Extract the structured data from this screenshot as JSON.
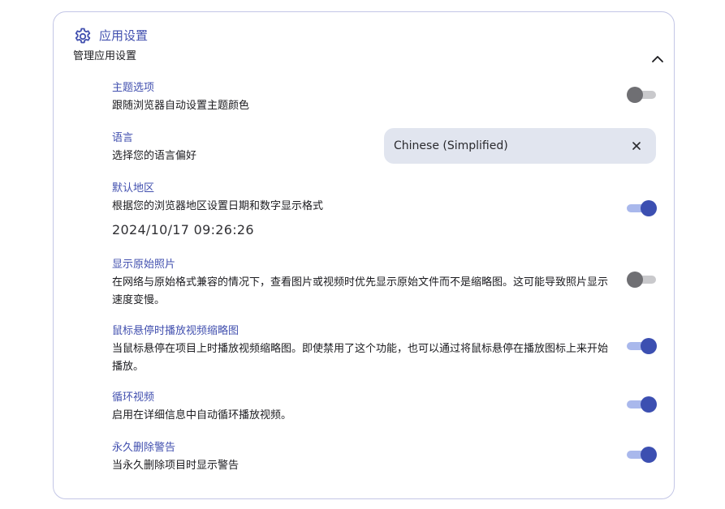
{
  "card": {
    "title": "应用设置",
    "subtitle": "管理应用设置",
    "icon": "gear-icon",
    "collapse_icon": "chevron-up-icon"
  },
  "colors": {
    "accent": "#4250af",
    "toggle_on_thumb": "#3c4fb1",
    "toggle_on_track": "#a9b8ec",
    "toggle_off_thumb": "#6f6f73",
    "toggle_off_track": "#c9c9cc",
    "select_bg": "#e1e5ef"
  },
  "settings": {
    "theme": {
      "title": "主题选项",
      "desc": "跟随浏览器自动设置主题颜色",
      "enabled": false
    },
    "language": {
      "title": "语言",
      "desc": "选择您的语言偏好",
      "value": "Chinese (Simplified)",
      "clear_icon": "close-icon"
    },
    "locale": {
      "title": "默认地区",
      "desc": "根据您的浏览器地区设置日期和数字显示格式",
      "example": "2024/10/17 09:26:26",
      "enabled": true
    },
    "original_photos": {
      "title": "显示原始照片",
      "desc": "在网络与原始格式兼容的情况下，查看图片或视频时优先显示原始文件而不是缩略图。这可能导致照片显示速度变慢。",
      "enabled": false
    },
    "hover_play": {
      "title": "鼠标悬停时播放视频缩略图",
      "desc": "当鼠标悬停在项目上时播放视频缩略图。即使禁用了这个功能，也可以通过将鼠标悬停在播放图标上来开始播放。",
      "enabled": true
    },
    "loop_video": {
      "title": "循环视频",
      "desc": "启用在详细信息中自动循环播放视频。",
      "enabled": true
    },
    "delete_warning": {
      "title": "永久删除警告",
      "desc": "当永久删除项目时显示警告",
      "enabled": true
    }
  }
}
